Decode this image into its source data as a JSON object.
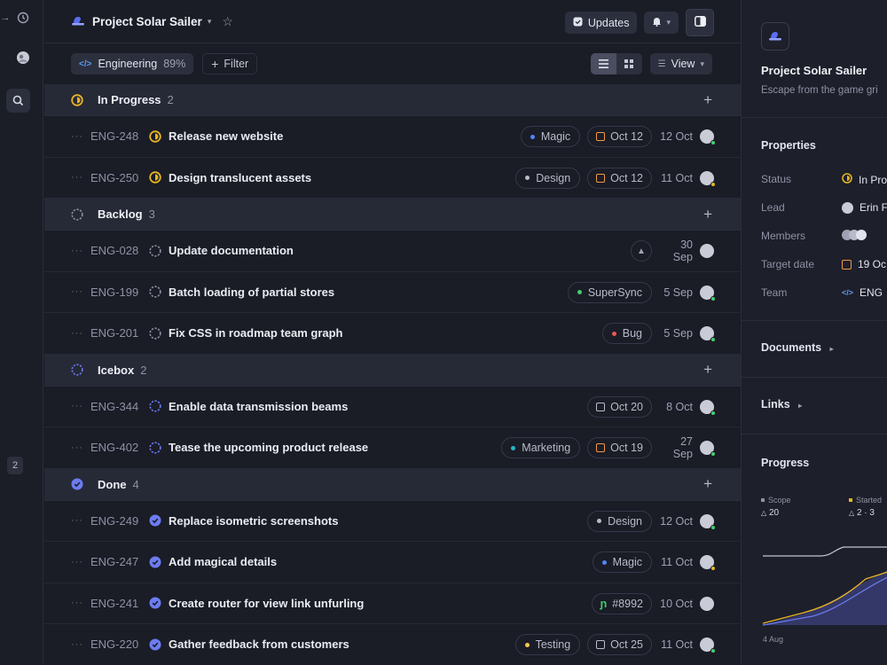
{
  "rail": {
    "badge": "2"
  },
  "header": {
    "project_title": "Project Solar Sailer",
    "updates_label": "Updates"
  },
  "filters": {
    "team_label": "Engineering",
    "team_pct": "89%",
    "filter_label": "Filter",
    "view_label": "View"
  },
  "groups": [
    {
      "name": "In Progress",
      "count": "2",
      "status": "in-progress",
      "issues": [
        {
          "id": "ENG-248",
          "title": "Release new website",
          "tag": "Magic",
          "tag_color": "#4f86f7",
          "due": "Oct 12",
          "date": "12 Oct",
          "presence": "online"
        },
        {
          "id": "ENG-250",
          "title": "Design translucent assets",
          "tag": "Design",
          "tag_color": "#b8bbc9",
          "due": "Oct 12",
          "date": "11 Oct",
          "presence": "away"
        }
      ]
    },
    {
      "name": "Backlog",
      "count": "3",
      "status": "backlog",
      "issues": [
        {
          "id": "ENG-028",
          "title": "Update documentation",
          "priority": "high",
          "date": "30 Sep",
          "presence": "none"
        },
        {
          "id": "ENG-199",
          "title": "Batch loading of partial stores",
          "tag": "SuperSync",
          "tag_color": "#3ecf6e",
          "date": "5 Sep",
          "presence": "online"
        },
        {
          "id": "ENG-201",
          "title": "Fix CSS in roadmap team graph",
          "tag": "Bug",
          "tag_color": "#eb5757",
          "date": "5 Sep",
          "presence": "online"
        }
      ]
    },
    {
      "name": "Icebox",
      "count": "2",
      "status": "icebox",
      "issues": [
        {
          "id": "ENG-344",
          "title": "Enable data transmission beams",
          "due": "Oct 20",
          "due_style": "neutral",
          "date": "8 Oct",
          "presence": "online"
        },
        {
          "id": "ENG-402",
          "title": "Tease the upcoming product release",
          "tag": "Marketing",
          "tag_color": "#26b5ce",
          "due": "Oct 19",
          "date": "27 Sep",
          "presence": "online"
        }
      ]
    },
    {
      "name": "Done",
      "count": "4",
      "status": "done",
      "issues": [
        {
          "id": "ENG-249",
          "title": "Replace isometric screenshots",
          "tag": "Design",
          "tag_color": "#b8bbc9",
          "date": "12 Oct",
          "presence": "online"
        },
        {
          "id": "ENG-247",
          "title": "Add magical details",
          "tag": "Magic",
          "tag_color": "#4f86f7",
          "date": "11 Oct",
          "presence": "away"
        },
        {
          "id": "ENG-241",
          "title": "Create router for view link unfurling",
          "pr": "#8992",
          "date": "10 Oct",
          "presence": "none"
        },
        {
          "id": "ENG-220",
          "title": "Gather feedback from customers",
          "tag": "Testing",
          "tag_color": "#f2c94c",
          "due": "Oct 25",
          "due_style": "neutral",
          "date": "11 Oct",
          "presence": "online"
        }
      ]
    }
  ],
  "panel": {
    "title": "Project Solar Sailer",
    "subtitle": "Escape from the game gri",
    "properties_title": "Properties",
    "props": [
      {
        "label": "Status",
        "value": "In Pro"
      },
      {
        "label": "Lead",
        "value": "Erin F"
      },
      {
        "label": "Members",
        "value": ""
      },
      {
        "label": "Target date",
        "value": "19 Oc"
      },
      {
        "label": "Team",
        "value": "ENG"
      }
    ],
    "documents_label": "Documents",
    "links_label": "Links",
    "progress_title": "Progress",
    "legend": [
      {
        "label": "Scope",
        "value": "20",
        "color": "#8e92a4"
      },
      {
        "label": "Started",
        "value": "2 · 3",
        "color": "#e6b422"
      }
    ],
    "chart_x_label": "4 Aug"
  },
  "colors": {
    "in_progress": "#e6b422",
    "done": "#6c7cf0",
    "icebox": "#6c7cf0",
    "backlog": "#8e92a4",
    "due_orange": "#f2994a"
  }
}
